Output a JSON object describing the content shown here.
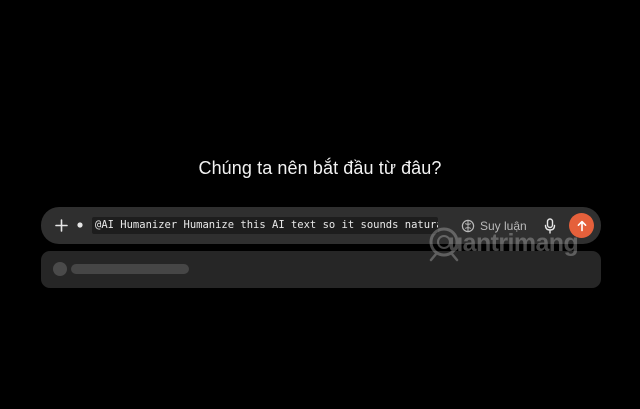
{
  "main": {
    "headline": "Chúng ta nên bắt đầu từ đâu?"
  },
  "composer": {
    "prompt_text": "@AI Humanizer Humanize this AI text so it sounds natural",
    "reasoning_label": "Suy luận",
    "accent_color": "#e5603b",
    "icons": {
      "add": "plus-icon",
      "tool": "dot-icon",
      "reasoning": "globe-icon",
      "voice": "microphone-icon",
      "send": "arrow-up-icon"
    }
  },
  "watermark": {
    "text": "uantrimang"
  }
}
